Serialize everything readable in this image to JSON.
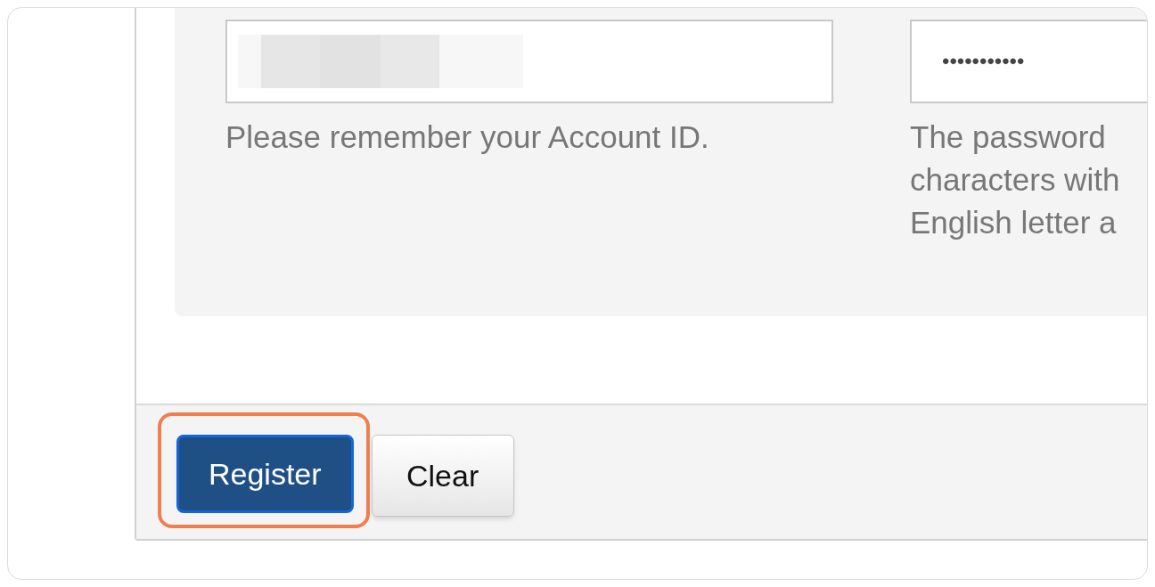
{
  "fields": [
    {
      "kind": "redacted",
      "help_lines": [
        "Please remember your Account ID."
      ]
    },
    {
      "kind": "password",
      "value": "•••••••••••",
      "help_lines": [
        "The password",
        "characters with",
        "English letter a"
      ]
    }
  ],
  "buttons": [
    {
      "label": "Register",
      "kind": "primary",
      "highlighted": true
    },
    {
      "label": "Clear",
      "kind": "secondary",
      "highlighted": false
    }
  ]
}
